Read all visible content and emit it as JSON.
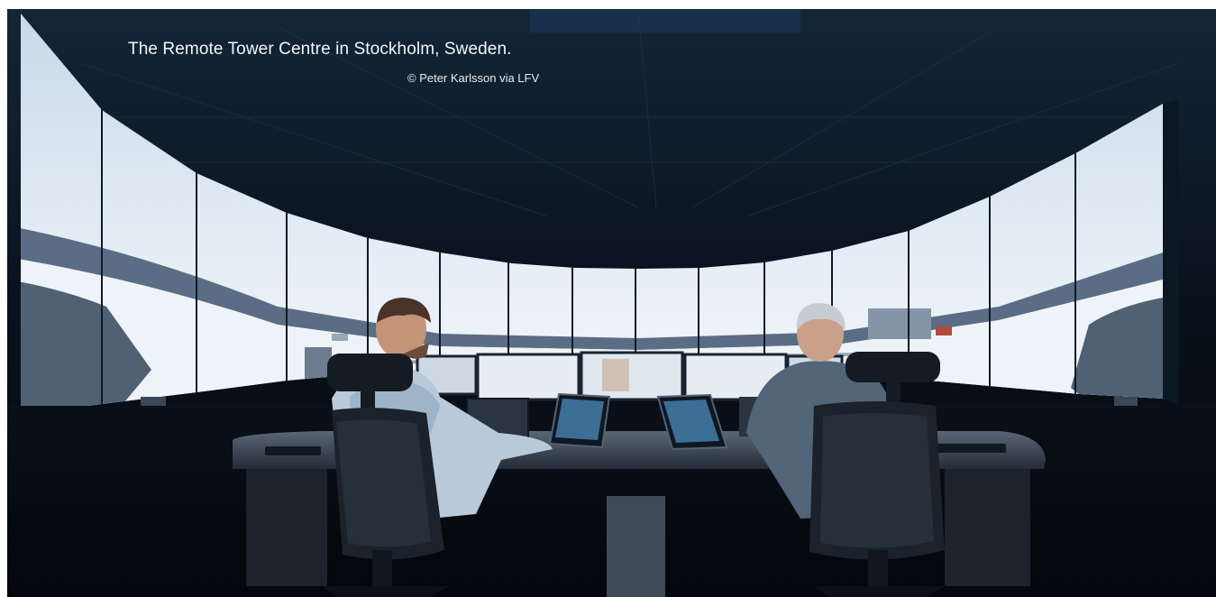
{
  "photo": {
    "caption": "The Remote Tower Centre in Stockholm, Sweden.",
    "credit": "© Peter Karlsson via LFV",
    "alt": "Two air traffic controllers at desks facing a curved wall of screens showing a snowy airfield panorama",
    "colors": {
      "ceiling": "#0b1522",
      "screen_sky": "#dfe9f3",
      "snow": "#eef3f8",
      "forest": "#2c3e55",
      "desk": "#2a3340",
      "floor": "#05090f"
    }
  }
}
